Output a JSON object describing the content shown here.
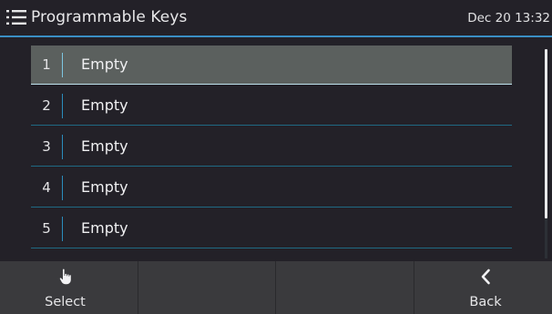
{
  "header": {
    "title": "Programmable Keys",
    "clock": "Dec 20 13:32",
    "menu_icon": "list-menu-icon"
  },
  "list": {
    "selected_index": 0,
    "items": [
      {
        "index": "1",
        "label": "Empty"
      },
      {
        "index": "2",
        "label": "Empty"
      },
      {
        "index": "3",
        "label": "Empty"
      },
      {
        "index": "4",
        "label": "Empty"
      },
      {
        "index": "5",
        "label": "Empty"
      }
    ]
  },
  "softkeys": [
    {
      "label": "Select",
      "icon": "hand-pointer-icon"
    },
    {
      "label": "",
      "icon": ""
    },
    {
      "label": "",
      "icon": ""
    },
    {
      "label": "Back",
      "icon": "chevron-left-icon"
    }
  ],
  "colors": {
    "background": "#232128",
    "accent": "#3a8fc4",
    "selected_row": "#5b605e",
    "softkey_bar": "#3a3a3d"
  }
}
